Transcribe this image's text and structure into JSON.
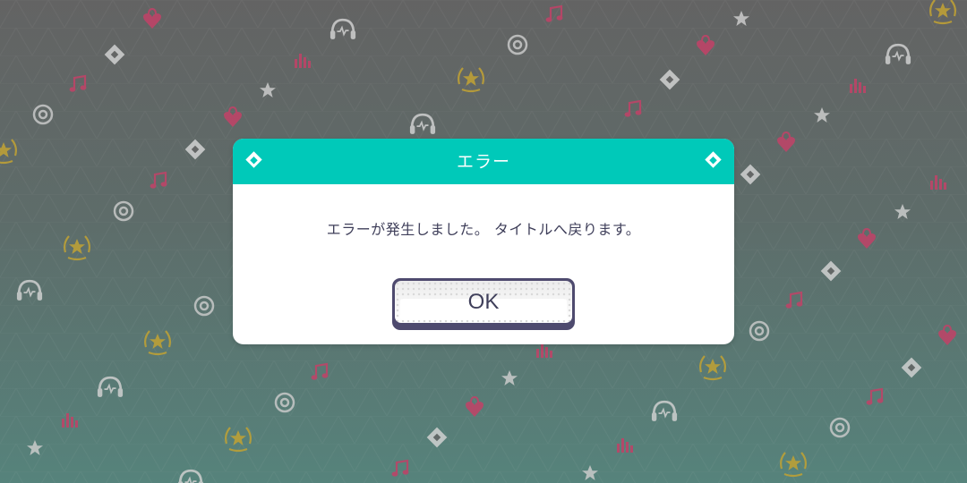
{
  "dialog": {
    "title": "エラー",
    "message": "エラーが発生しました。 タイトルへ戻ります。",
    "ok_label": "OK"
  },
  "colors": {
    "header": "#00c9b9",
    "text": "#3f3f5a",
    "button_border": "#4e4a6e",
    "icon_heart": "#c9486e",
    "icon_star_badge": "#c9a93a",
    "icon_light": "#cfcfcf"
  },
  "background_icons": [
    "heart-lock-icon",
    "music-note-icon",
    "star-icon",
    "star-badge-icon",
    "headphones-icon",
    "disc-icon",
    "diamond-icon",
    "equalizer-icon"
  ]
}
